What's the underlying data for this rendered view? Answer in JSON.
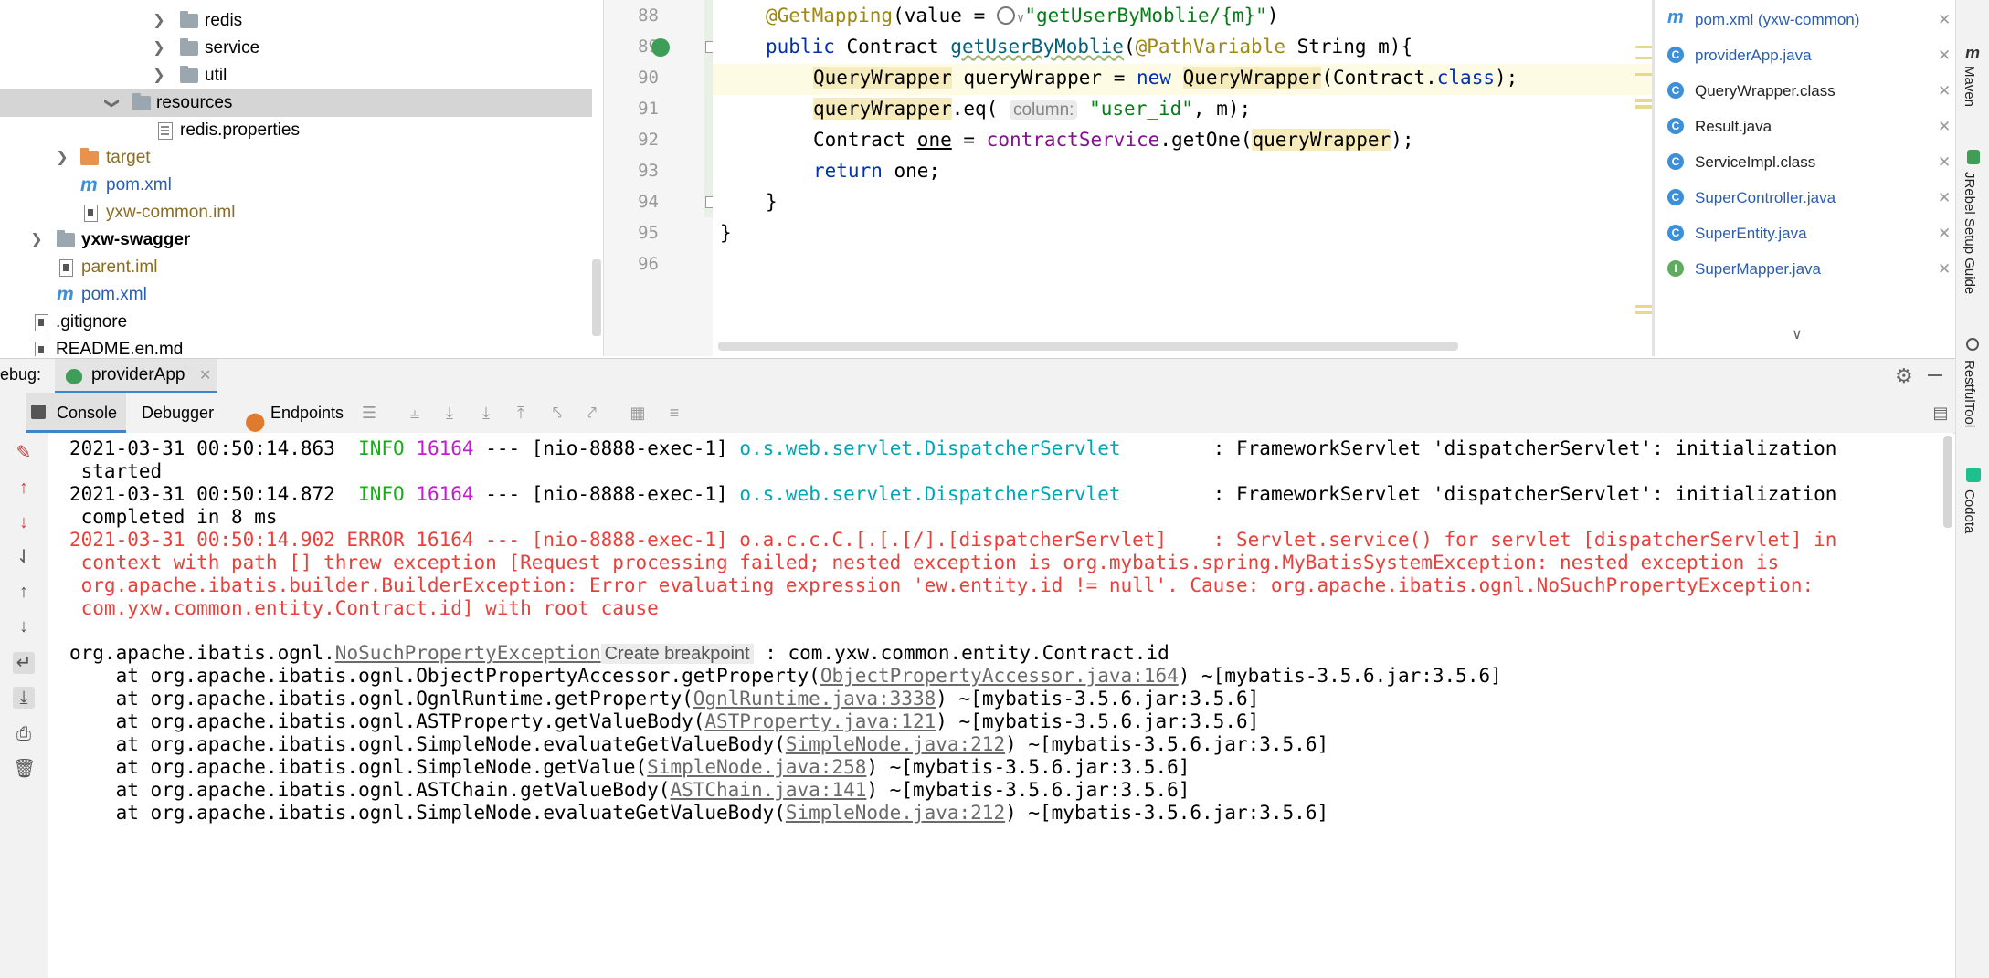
{
  "project_tree": {
    "rows": [
      {
        "label": "redis",
        "kind": "folder"
      },
      {
        "label": "service",
        "kind": "folder"
      },
      {
        "label": "util",
        "kind": "folder"
      },
      {
        "label": "resources",
        "kind": "folder"
      },
      {
        "label": "redis.properties",
        "kind": "properties"
      },
      {
        "label": "target",
        "kind": "folder-orange"
      },
      {
        "label": "pom.xml",
        "kind": "maven"
      },
      {
        "label": "yxw-common.iml",
        "kind": "iml"
      },
      {
        "label": "yxw-swagger",
        "kind": "module"
      },
      {
        "label": "parent.iml",
        "kind": "iml"
      },
      {
        "label": "pom.xml",
        "kind": "maven"
      },
      {
        "label": ".gitignore",
        "kind": "file"
      },
      {
        "label": "README.en.md",
        "kind": "file"
      }
    ]
  },
  "editor": {
    "line_numbers": [
      "88",
      "89",
      "90",
      "91",
      "92",
      "93",
      "94",
      "95",
      "96"
    ],
    "lines": {
      "l88": {
        "ann": "@GetMapping",
        "a": "(value = ",
        "str": "\"getUserByMoblie/{m}\"",
        "b": ")"
      },
      "l89": {
        "kw": "public",
        "a": " Contract ",
        "fn": "getUserByMoblie",
        "b": "(",
        "ann": "@PathVariable",
        "c": " String m){"
      },
      "l90": {
        "a": "QueryWrapper",
        "b": " queryWrapper = ",
        "kw": "new",
        "c": " ",
        "d": "QueryWrapper",
        "e": "(Contract.",
        "kw2": "class",
        "f": ");"
      },
      "l91": {
        "a": "queryWrapper",
        "b": ".eq( ",
        "hint": "column:",
        "c": " ",
        "str": "\"user_id\"",
        "d": ", m);"
      },
      "l92": {
        "a": "Contract ",
        "b": "one",
        "c": " = ",
        "fld": "contractService",
        "d": ".getOne(",
        "e": "queryWrapper",
        "f": ");"
      },
      "l93": {
        "kw": "return",
        "a": " one;"
      },
      "l94": {
        "a": "}"
      },
      "l95": {
        "a": "}"
      }
    }
  },
  "recent_files": [
    {
      "label": "pom.xml (yxw-common)",
      "icon": "m",
      "color": "#3d8fd8"
    },
    {
      "label": "providerApp.java",
      "icon": "C",
      "color": "#3d8fd8"
    },
    {
      "label": "QueryWrapper.class",
      "icon": "C",
      "color": "#3d8fd8"
    },
    {
      "label": "Result.java",
      "icon": "C",
      "color": "#3d8fd8"
    },
    {
      "label": "ServiceImpl.class",
      "icon": "C",
      "color": "#3d8fd8"
    },
    {
      "label": "SuperController.java",
      "icon": "C",
      "color": "#3d8fd8"
    },
    {
      "label": "SuperEntity.java",
      "icon": "C",
      "color": "#3d8fd8"
    },
    {
      "label": "SuperMapper.java",
      "icon": "I",
      "color": "#5fab5f"
    }
  ],
  "right_stripe": [
    "Maven",
    "JRebel Setup Guide",
    "RestfulTool",
    "Codota"
  ],
  "debug": {
    "label": "ebug:",
    "run_config": "providerApp",
    "tabs": {
      "console": "Console",
      "debugger": "Debugger",
      "endpoints": "Endpoints"
    }
  },
  "console": {
    "lines": [
      {
        "ts": "2021-03-31 00:50:14.863",
        "level": "INFO",
        "pid": "16164",
        "thread": " --- [nio-8888-exec-1] ",
        "logger": "o.s.web.servlet.DispatcherServlet",
        "msg": "        : FrameworkServlet 'dispatcherServlet': initialization"
      },
      {
        "cont": " started"
      },
      {
        "ts": "2021-03-31 00:50:14.872",
        "level": "INFO",
        "pid": "16164",
        "thread": " --- [nio-8888-exec-1] ",
        "logger": "o.s.web.servlet.DispatcherServlet",
        "msg": "        : FrameworkServlet 'dispatcherServlet': initialization"
      },
      {
        "cont": " completed in 8 ms"
      },
      {
        "err": "2021-03-31 00:50:14.902 ERROR 16164 --- [nio-8888-exec-1] o.a.c.c.C.[.[.[/].[dispatcherServlet]    : Servlet.service() for servlet [dispatcherServlet] in"
      },
      {
        "err": " context with path [] threw exception [Request processing failed; nested exception is org.mybatis.spring.MyBatisSystemException: nested exception is"
      },
      {
        "err": " org.apache.ibatis.builder.BuilderException: Error evaluating expression 'ew.entity.id != null'. Cause: org.apache.ibatis.ognl.NoSuchPropertyException:"
      },
      {
        "err": " com.yxw.common.entity.Contract.id] with root cause"
      }
    ],
    "exception": {
      "prefix": "org.apache.ibatis.ognl.",
      "name": "NoSuchPropertyException",
      "bp": "Create breakpoint",
      "suffix": " : com.yxw.common.entity.Contract.id"
    },
    "stack": [
      {
        "at": "    at org.apache.ibatis.ognl.ObjectPropertyAccessor.getProperty(",
        "link": "ObjectPropertyAccessor.java:164",
        "jar": ") ~[mybatis-3.5.6.jar:3.5.6]"
      },
      {
        "at": "    at org.apache.ibatis.ognl.OgnlRuntime.getProperty(",
        "link": "OgnlRuntime.java:3338",
        "jar": ") ~[mybatis-3.5.6.jar:3.5.6]"
      },
      {
        "at": "    at org.apache.ibatis.ognl.ASTProperty.getValueBody(",
        "link": "ASTProperty.java:121",
        "jar": ") ~[mybatis-3.5.6.jar:3.5.6]"
      },
      {
        "at": "    at org.apache.ibatis.ognl.SimpleNode.evaluateGetValueBody(",
        "link": "SimpleNode.java:212",
        "jar": ") ~[mybatis-3.5.6.jar:3.5.6]"
      },
      {
        "at": "    at org.apache.ibatis.ognl.SimpleNode.getValue(",
        "link": "SimpleNode.java:258",
        "jar": ") ~[mybatis-3.5.6.jar:3.5.6]"
      },
      {
        "at": "    at org.apache.ibatis.ognl.ASTChain.getValueBody(",
        "link": "ASTChain.java:141",
        "jar": ") ~[mybatis-3.5.6.jar:3.5.6]"
      },
      {
        "at": "    at org.apache.ibatis.ognl.SimpleNode.evaluateGetValueBody(",
        "link": "SimpleNode.java:212",
        "jar": ") ~[mybatis-3.5.6.jar:3.5.6]"
      }
    ]
  }
}
